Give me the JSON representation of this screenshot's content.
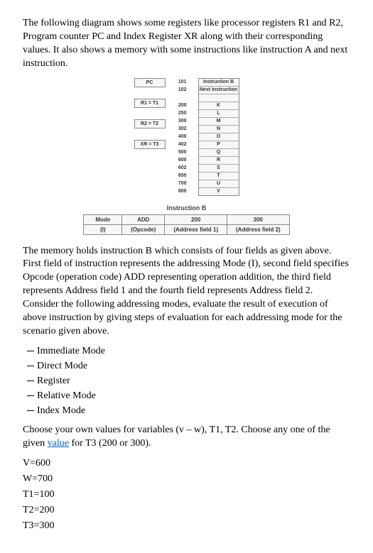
{
  "intro": "The following diagram shows some registers like processor registers R1 and R2, Program counter PC and Index Register XR along with their corresponding values. It also shows a memory with some instructions like instruction A and next instruction.",
  "registers": {
    "pc": "PC",
    "r1": "R1 = T1",
    "r2": "R2 = T2",
    "xr": "XR = T3"
  },
  "addr": [
    "101",
    "102",
    "",
    "200",
    "250",
    "300",
    "302",
    "400",
    "402",
    "500",
    "600",
    "602",
    "650",
    "700",
    "800"
  ],
  "mem_top": {
    "a": "Instruction B",
    "b": "Next Instruction"
  },
  "mem_vals": [
    "K",
    "L",
    "M",
    "N",
    "O",
    "P",
    "Q",
    "R",
    "S",
    "T",
    "U",
    "V"
  ],
  "instrB": {
    "label": "Instruction B",
    "r1c1": "Mode",
    "r1c2": "ADD",
    "r1c3": "200",
    "r1c4": "300",
    "r2c1": "(I)",
    "r2c2": "(Opcode)",
    "r2c3": "(Address field 1)",
    "r2c4": "(Address field 2)"
  },
  "body": "The memory holds instruction B which consists of four fields as given above. First field of instruction represents the addressing Mode (I), second field specifies Opcode (operation code) ADD representing operation addition, the third field represents Address field 1 and the fourth field represents Address field 2. Consider the following addressing modes, evaluate the result of execution of above instruction by giving steps of evaluation for each addressing mode for the scenario given above.",
  "modes": {
    "m1": "Immediate Mode",
    "m2": "Direct Mode",
    "m3": "Register",
    "m4": "Relative Mode",
    "m5": "Index Mode"
  },
  "choose_pre": "Choose your own values for variables (v – w), T1, T2. Choose any one of the given ",
  "choose_link": "value",
  "choose_post": " for T3 (200 or 300).",
  "vals": {
    "v": "V=600",
    "w": "W=700",
    "t1": "T1=100",
    "t2": "T2=200",
    "t3": "T3=300"
  }
}
